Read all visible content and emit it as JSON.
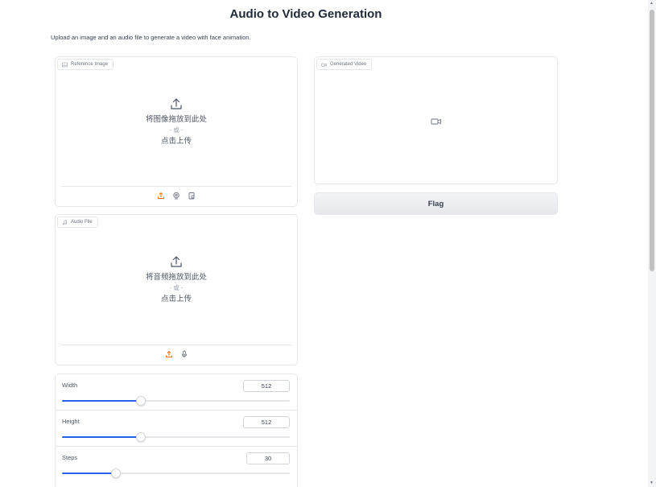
{
  "page": {
    "title": "Audio to Video Generation",
    "description": "Upload an image and an audio file to generate a video with face animation."
  },
  "reference_image": {
    "label": "Reference Image",
    "label_icon": "image-icon",
    "drop_text": "将图像拖放到此处",
    "or_text": "- 或 -",
    "click_text": "点击上传",
    "sources": [
      "upload-icon",
      "webcam-icon",
      "clipboard-icon"
    ]
  },
  "audio_file": {
    "label": "Audio File",
    "label_icon": "music-icon",
    "drop_text": "将音频拖放到此处",
    "or_text": "- 或 -",
    "click_text": "点击上传",
    "sources": [
      "upload-icon",
      "microphone-icon"
    ]
  },
  "generated_video": {
    "label": "Generated Video",
    "label_icon": "video-icon",
    "placeholder_icon": "video-camera-icon"
  },
  "flag_button": {
    "label": "Flag"
  },
  "sliders": [
    {
      "label": "Width",
      "value": "512",
      "fraction": 0.345
    },
    {
      "label": "Height",
      "value": "512",
      "fraction": 0.345
    },
    {
      "label": "Steps",
      "value": "30",
      "fraction": 0.235
    }
  ],
  "colors": {
    "accent": "#2563eb",
    "upload_icon_active": "#f97316",
    "border": "#e5e7eb"
  }
}
